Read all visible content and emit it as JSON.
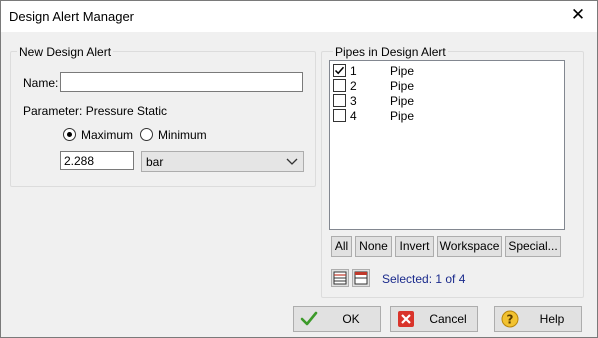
{
  "window": {
    "title": "Design Alert Manager",
    "close_glyph": "✕"
  },
  "new_alert": {
    "group_label": "New Design Alert",
    "name_label": "Name:",
    "name_value": "",
    "parameter_label": "Parameter: Pressure Static",
    "maximum_label": "Maximum",
    "minimum_label": "Minimum",
    "selected_option": "Maximum",
    "value": "2.288",
    "unit": "bar"
  },
  "pipes": {
    "group_label": "Pipes in Design Alert",
    "items": [
      {
        "num": "1",
        "type": "Pipe",
        "checked": true
      },
      {
        "num": "2",
        "type": "Pipe",
        "checked": false
      },
      {
        "num": "3",
        "type": "Pipe",
        "checked": false
      },
      {
        "num": "4",
        "type": "Pipe",
        "checked": false
      }
    ],
    "buttons": {
      "all": "All",
      "none": "None",
      "invert": "Invert",
      "workspace": "Workspace",
      "special": "Special..."
    },
    "selected_text": "Selected: 1 of 4",
    "selected_text_color": "#1a2a8c"
  },
  "footer": {
    "ok_label": "OK",
    "cancel_label": "Cancel",
    "help_label": "Help"
  }
}
